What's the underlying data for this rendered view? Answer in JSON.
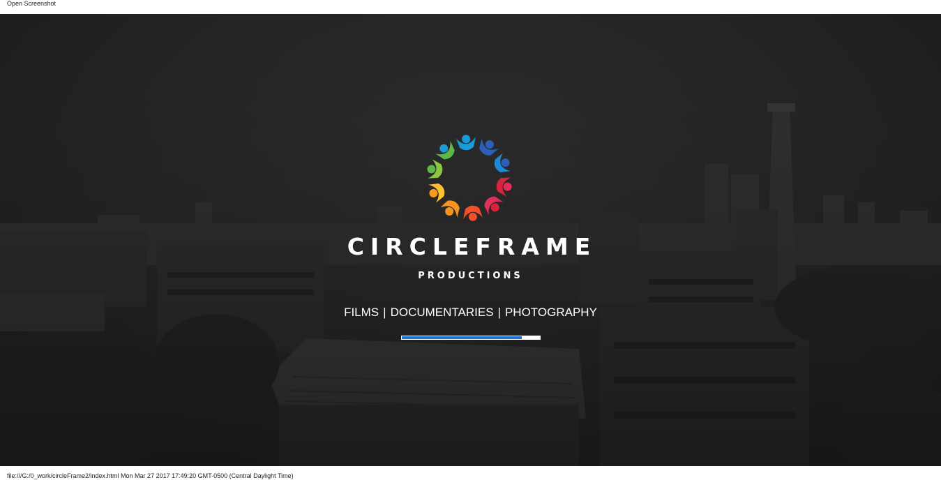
{
  "top_bar": {
    "label": "Open Screenshot"
  },
  "brand": {
    "title": "CIRCLEFRAME",
    "subtitle": "PRODUCTIONS",
    "tagline": [
      "FILMS",
      "DOCUMENTARIES",
      "PHOTOGRAPHY"
    ],
    "separator": "|"
  },
  "loader": {
    "progress": 0.87,
    "track_color": "#ffffff",
    "fill_color": "#1a73d9"
  },
  "logo": {
    "icon": "circle-of-people-logo",
    "colors": [
      "#1e88d6",
      "#2b5fb8",
      "#d8233d",
      "#e0305a",
      "#f0502a",
      "#f7941d",
      "#fbc02d",
      "#f59b1f",
      "#5db847",
      "#1a9ad6"
    ]
  },
  "status_bar": {
    "text": "file:///G:/0_work/circleFrame2/index.html Mon Mar 27 2017 17:49:20 GMT-0500 (Central Daylight Time)"
  }
}
